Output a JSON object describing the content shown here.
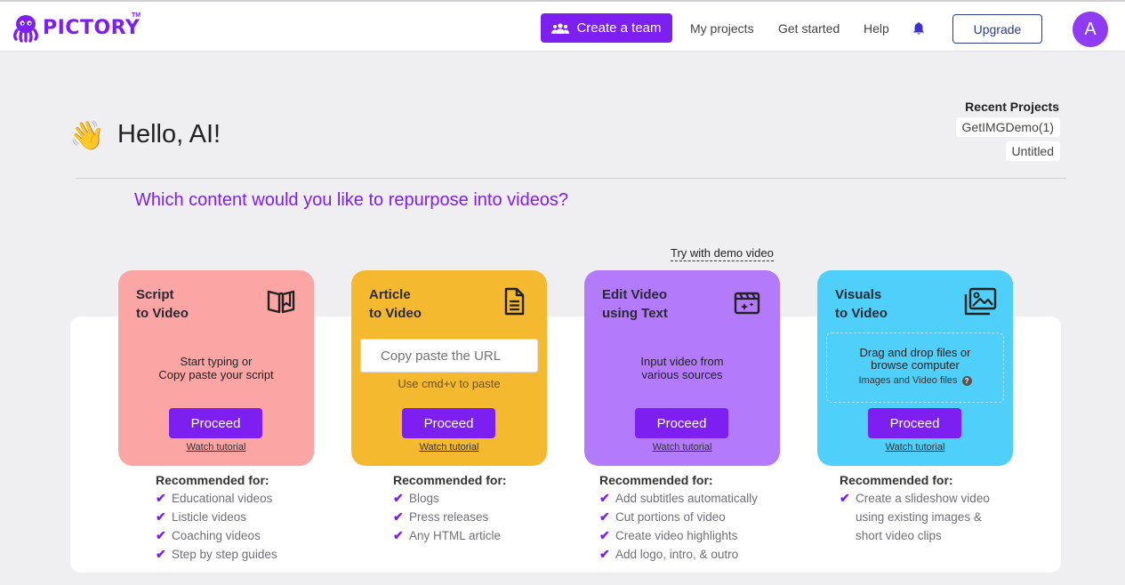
{
  "header": {
    "logo_text": "PICTORY",
    "logo_tm": "TM",
    "create_team_label": "Create a team",
    "nav": [
      "My projects",
      "Get started",
      "Help"
    ],
    "upgrade_label": "Upgrade",
    "avatar_initial": "A",
    "brand_color": "#7c1ff0"
  },
  "greeting": {
    "emoji": "👋",
    "text": "Hello, AI!"
  },
  "recent_projects": {
    "title": "Recent Projects",
    "items": [
      "GetIMGDemo(1)",
      "Untitled"
    ]
  },
  "question": "Which content would you like to repurpose into videos?",
  "try_demo": "Try with demo video",
  "cards": [
    {
      "title_line1": "Script",
      "title_line2": "to Video",
      "icon": "open-book-icon",
      "color": "#fca5a5",
      "desc_line1": "Start typing or",
      "desc_line2": "Copy paste your script",
      "proceed": "Proceed",
      "watch": "Watch tutorial"
    },
    {
      "title_line1": "Article",
      "title_line2": "to Video",
      "icon": "document-icon",
      "color": "#f4b92f",
      "input_placeholder": "Copy paste the URL",
      "hint": "Use cmd+v to paste",
      "proceed": "Proceed",
      "watch": "Watch tutorial"
    },
    {
      "title_line1": "Edit Video",
      "title_line2": "using Text",
      "icon": "clapperboard-icon",
      "color": "#b37afc",
      "desc_line1": "Input video from",
      "desc_line2": "various sources",
      "proceed": "Proceed",
      "watch": "Watch tutorial"
    },
    {
      "title_line1": "Visuals",
      "title_line2": "to Video",
      "icon": "images-icon",
      "color": "#4fd0fb",
      "drop_line1": "Drag and drop files or",
      "drop_line2": "browse computer",
      "drop_sub": "Images and Video files",
      "proceed": "Proceed",
      "watch": "Watch tutorial"
    }
  ],
  "recommended": [
    {
      "title": "Recommended for:",
      "items": [
        "Educational videos",
        "Listicle videos",
        "Coaching videos",
        "Step by step guides"
      ]
    },
    {
      "title": "Recommended for:",
      "items": [
        "Blogs",
        "Press releases",
        "Any HTML article"
      ]
    },
    {
      "title": "Recommended for:",
      "items": [
        "Add subtitles automatically",
        "Cut portions of video",
        "Create video highlights",
        "Add logo, intro, & outro"
      ]
    },
    {
      "title": "Recommended for:",
      "items": [
        "Create a slideshow video",
        "using existing images &",
        "short video clips"
      ]
    }
  ]
}
